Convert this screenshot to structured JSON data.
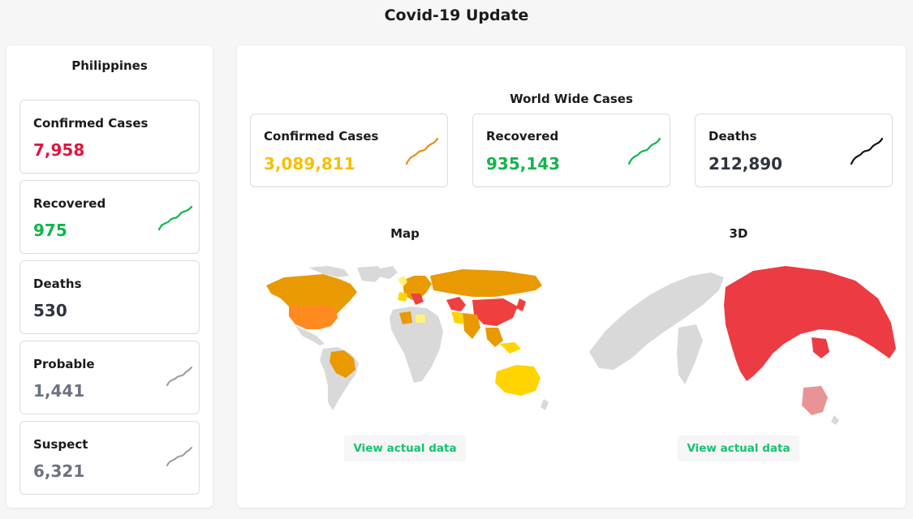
{
  "app": {
    "title": "Covid-19 Update"
  },
  "country": {
    "name": "Philippines",
    "stats": [
      {
        "label": "Confirmed Cases",
        "value": "7,958",
        "color": "#e0163e",
        "trend": "none"
      },
      {
        "label": "Recovered",
        "value": "975",
        "color": "#12b54b",
        "trend": "green"
      },
      {
        "label": "Deaths",
        "value": "530",
        "color": "#2e3440",
        "trend": "none"
      },
      {
        "label": "Probable",
        "value": "1,441",
        "color": "#6b7280",
        "trend": "gray"
      },
      {
        "label": "Suspect",
        "value": "6,321",
        "color": "#6b7280",
        "trend": "gray"
      }
    ]
  },
  "world": {
    "title": "World Wide Cases",
    "stats": [
      {
        "label": "Confirmed Cases",
        "value": "3,089,811",
        "color": "#f5c000",
        "trend": "orange"
      },
      {
        "label": "Recovered",
        "value": "935,143",
        "color": "#12b54b",
        "trend": "green"
      },
      {
        "label": "Deaths",
        "value": "212,890",
        "color": "#2e3440",
        "trend": "black"
      }
    ]
  },
  "maps": {
    "flat_title": "Map",
    "globe_title": "3D",
    "view_label": "View actual data",
    "colors": {
      "land": "#d9d9d9",
      "high": "#ef3f3f",
      "elevated": "#ff8a1f",
      "medium": "#e89a00",
      "low": "#ffd400",
      "lowest": "#fff27a",
      "globe_red": "#ec3b43",
      "globe_pink": "#e99494"
    }
  }
}
